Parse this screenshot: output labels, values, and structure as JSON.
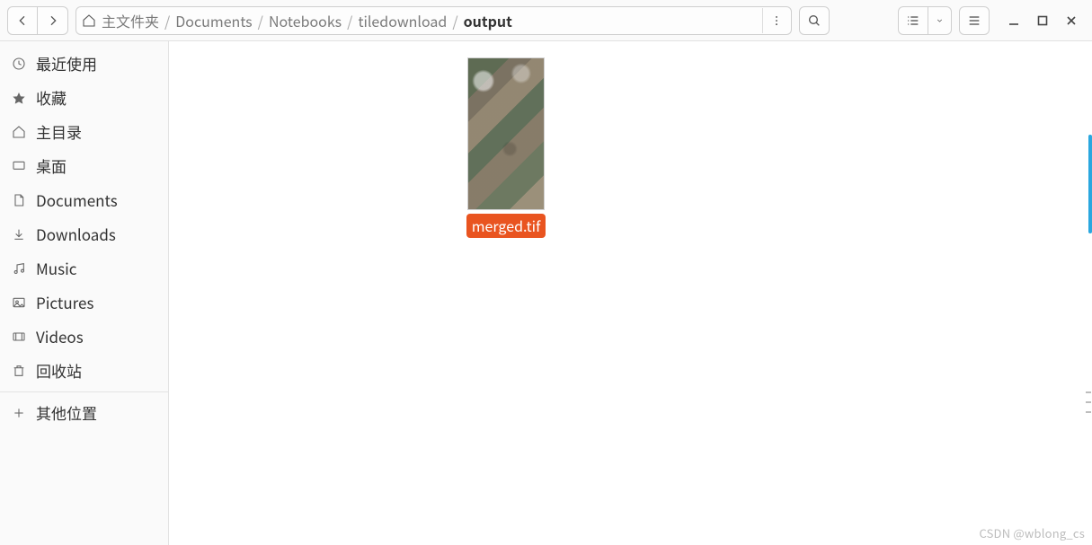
{
  "breadcrumb": {
    "items": [
      {
        "label": "主文件夹",
        "current": false
      },
      {
        "label": "Documents",
        "current": false
      },
      {
        "label": "Notebooks",
        "current": false
      },
      {
        "label": "tiledownload",
        "current": false
      },
      {
        "label": "output",
        "current": true
      }
    ]
  },
  "sidebar": {
    "items": [
      {
        "icon": "clock",
        "label": "最近使用"
      },
      {
        "icon": "star",
        "label": "收藏"
      },
      {
        "icon": "home",
        "label": "主目录"
      },
      {
        "icon": "desktop",
        "label": "桌面"
      },
      {
        "icon": "document",
        "label": "Documents"
      },
      {
        "icon": "download",
        "label": "Downloads"
      },
      {
        "icon": "music",
        "label": "Music"
      },
      {
        "icon": "picture",
        "label": "Pictures"
      },
      {
        "icon": "video",
        "label": "Videos"
      },
      {
        "icon": "trash",
        "label": "回收站"
      }
    ],
    "other": {
      "icon": "plus",
      "label": "其他位置"
    }
  },
  "files": [
    {
      "name": "merged.tif",
      "selected": true
    }
  ],
  "accent_color": "#e95420",
  "watermark": "CSDN @wblong_cs"
}
